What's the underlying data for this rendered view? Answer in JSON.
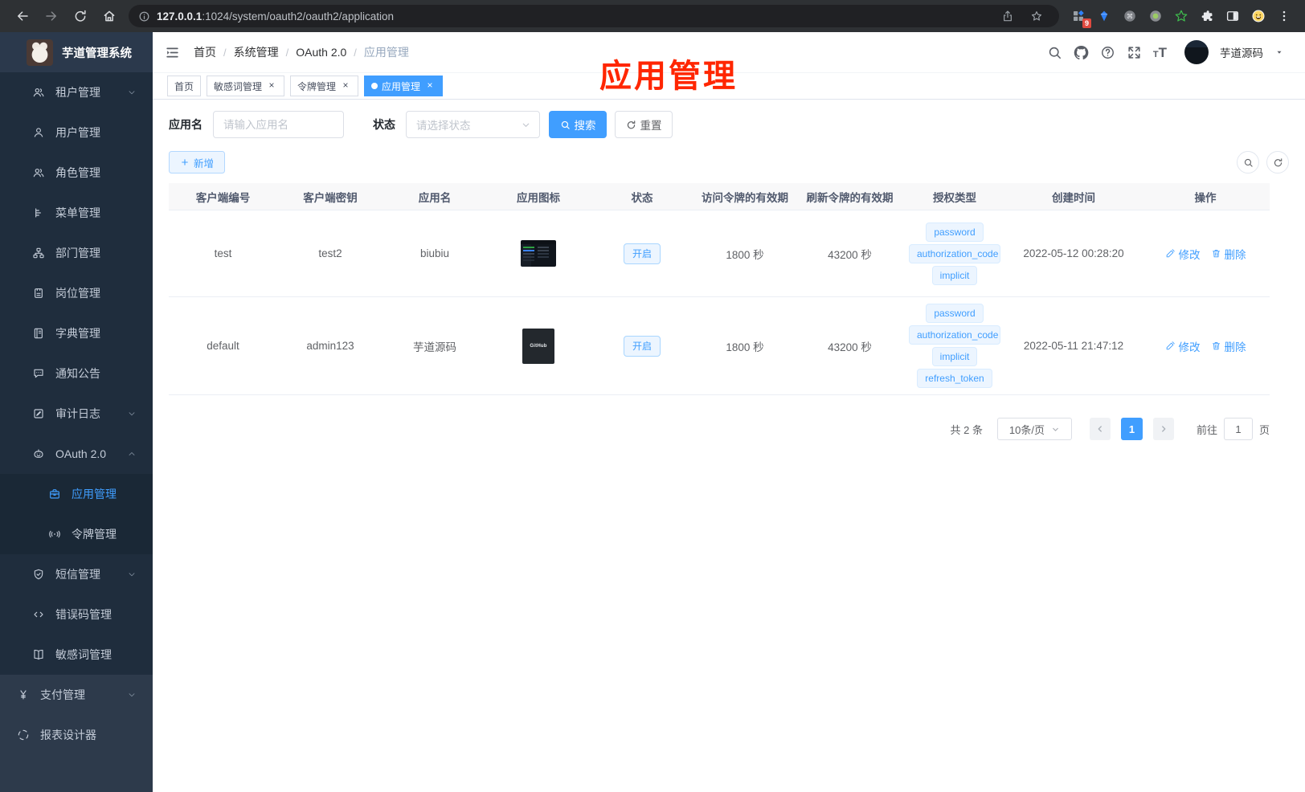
{
  "browser": {
    "url_host": "127.0.0.1",
    "url_rest": ":1024/system/oauth2/oauth2/application",
    "extension_badge": "9"
  },
  "app": {
    "sidebar": {
      "title": "芋道管理系统",
      "menu": [
        {
          "id": "tenant",
          "label": "租户管理",
          "icon": "users",
          "level": 1,
          "chevron": "down",
          "group": "system"
        },
        {
          "id": "user",
          "label": "用户管理",
          "icon": "user",
          "level": 1,
          "group": "system"
        },
        {
          "id": "role",
          "label": "角色管理",
          "icon": "users",
          "level": 1,
          "group": "system"
        },
        {
          "id": "menu",
          "label": "菜单管理",
          "icon": "menu-tree",
          "level": 1,
          "group": "system"
        },
        {
          "id": "dept",
          "label": "部门管理",
          "icon": "sitemap",
          "level": 1,
          "group": "system"
        },
        {
          "id": "post",
          "label": "岗位管理",
          "icon": "id-badge",
          "level": 1,
          "group": "system"
        },
        {
          "id": "dict",
          "label": "字典管理",
          "icon": "dictionary",
          "level": 1,
          "group": "system"
        },
        {
          "id": "notice",
          "label": "通知公告",
          "icon": "announcement",
          "level": 1,
          "group": "system"
        },
        {
          "id": "audit-log",
          "label": "审计日志",
          "icon": "audit-log",
          "level": 1,
          "chevron": "down",
          "group": "system"
        },
        {
          "id": "oauth2",
          "label": "OAuth 2.0",
          "icon": "robot",
          "level": 1,
          "chevron": "up",
          "group": "system"
        },
        {
          "id": "oauth2-application",
          "label": "应用管理",
          "icon": "briefcase",
          "level": 2,
          "active": true,
          "group": "system"
        },
        {
          "id": "oauth2-token",
          "label": "令牌管理",
          "icon": "token",
          "level": 2,
          "group": "system"
        },
        {
          "id": "sms",
          "label": "短信管理",
          "icon": "shield",
          "level": 1,
          "chevron": "down",
          "group": "system"
        },
        {
          "id": "error-code",
          "label": "错误码管理",
          "icon": "code",
          "level": 1,
          "group": "system"
        },
        {
          "id": "sensitive-word",
          "label": "敏感词管理",
          "icon": "book-open",
          "level": 1,
          "group": "system"
        },
        {
          "id": "pay",
          "label": "支付管理",
          "icon": "yen",
          "level": 0,
          "chevron": "down",
          "group": "root"
        },
        {
          "id": "report",
          "label": "报表设计器",
          "icon": "report",
          "level": 0,
          "group": "root"
        }
      ]
    },
    "header": {
      "breadcrumb": [
        "首页",
        "系统管理",
        "OAuth 2.0",
        "应用管理"
      ],
      "breadcrumb_separator": "/",
      "username": "芋道源码"
    },
    "tabs": {
      "close_symbol": "×",
      "items": [
        {
          "id": "home",
          "label": "首页",
          "closable": false,
          "active": false
        },
        {
          "id": "sensitive-word",
          "label": "敏感词管理",
          "closable": true,
          "active": false
        },
        {
          "id": "token",
          "label": "令牌管理",
          "closable": true,
          "active": false
        },
        {
          "id": "application",
          "label": "应用管理",
          "closable": true,
          "active": true
        }
      ]
    },
    "annotation": {
      "text": "应用管理",
      "color": "#ff2600"
    },
    "filters": {
      "name_label": "应用名",
      "name_placeholder": "请输入应用名",
      "status_label": "状态",
      "status_placeholder": "请选择状态",
      "search_label": "搜索",
      "reset_label": "重置"
    },
    "toolbar": {
      "add_label": "新增"
    },
    "table": {
      "headers": [
        "客户端编号",
        "客户端密钥",
        "应用名",
        "应用图标",
        "状态",
        "访问令牌的有效期",
        "刷新令牌的有效期",
        "授权类型",
        "创建时间",
        "操作"
      ],
      "rows": [
        {
          "client_id": "test",
          "client_secret": "test2",
          "name": "biubiu",
          "icon_kind": "dashboard-thumb",
          "icon_label": "",
          "status": "开启",
          "access_token_ttl": "1800 秒",
          "refresh_token_ttl": "43200 秒",
          "grant_types": [
            "password",
            "authorization_code",
            "implicit"
          ],
          "created_at": "2022-05-12 00:28:20"
        },
        {
          "client_id": "default",
          "client_secret": "admin123",
          "name": "芋道源码",
          "icon_kind": "github-thumb",
          "icon_label": "GitHub",
          "status": "开启",
          "access_token_ttl": "1800 秒",
          "refresh_token_ttl": "43200 秒",
          "grant_types": [
            "password",
            "authorization_code",
            "implicit",
            "refresh_token"
          ],
          "created_at": "2022-05-11 21:47:12"
        }
      ],
      "actions": {
        "edit": "修改",
        "delete": "删除"
      }
    },
    "pagination": {
      "total": "共 2 条",
      "page_size": "10条/页",
      "page": "1",
      "goto_label": "前往",
      "goto_value": "1",
      "page_unit": "页"
    },
    "colors": {
      "accent": "#409eff",
      "annotation_red": "#ff2600",
      "sidebar_bg": "#1f2d3d",
      "sidebar_bottom_bg": "#2d3a4b",
      "tag_bg": "#ecf5ff",
      "tag_border": "#d9ecff"
    }
  }
}
